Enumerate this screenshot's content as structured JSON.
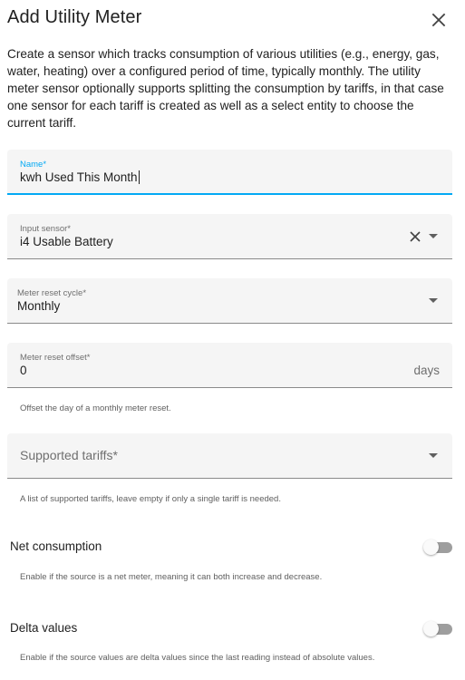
{
  "dialog": {
    "title": "Add Utility Meter",
    "description": "Create a sensor which tracks consumption of various utilities (e.g., energy, gas, water, heating) over a configured period of time, typically monthly. The utility meter sensor optionally supports splitting the consumption by tariffs, in that case one sensor for each tariff is created as well as a select entity to choose the current tariff."
  },
  "fields": {
    "name": {
      "label": "Name*",
      "value": "kwh Used This Month"
    },
    "input_sensor": {
      "label": "Input sensor*",
      "value": "i4 Usable Battery"
    },
    "meter_reset_cycle": {
      "label": "Meter reset cycle*",
      "value": "Monthly"
    },
    "meter_reset_offset": {
      "label": "Meter reset offset*",
      "value": "0",
      "suffix": "days",
      "helper": "Offset the day of a monthly meter reset."
    },
    "supported_tariffs": {
      "placeholder": "Supported tariffs*",
      "helper": "A list of supported tariffs, leave empty if only a single tariff is needed."
    }
  },
  "toggles": {
    "net_consumption": {
      "label": "Net consumption",
      "helper": "Enable if the source is a net meter, meaning it can both increase and decrease.",
      "enabled": false
    },
    "delta_values": {
      "label": "Delta values",
      "helper": "Enable if the source values are delta values since the last reading instead of absolute values.",
      "enabled": false
    }
  },
  "icons": {
    "close": "close-icon",
    "clear": "clear-icon",
    "dropdown": "chevron-down-icon"
  },
  "colors": {
    "accent": "#03a9f4",
    "field_background": "#f5f5f5",
    "toggle_off_track": "#9e9e9e"
  }
}
